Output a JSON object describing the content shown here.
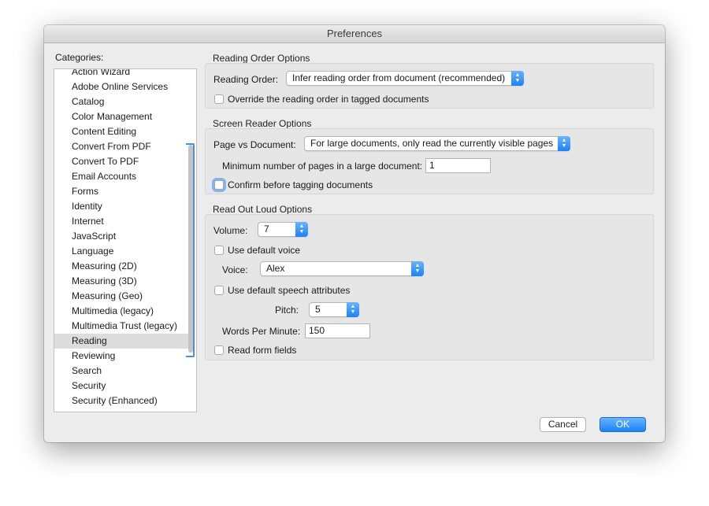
{
  "window": {
    "title": "Preferences"
  },
  "sidebar": {
    "label": "Categories:",
    "items": [
      {
        "label": "Action Wizard"
      },
      {
        "label": "Adobe Online Services"
      },
      {
        "label": "Catalog"
      },
      {
        "label": "Color Management"
      },
      {
        "label": "Content Editing"
      },
      {
        "label": "Convert From PDF"
      },
      {
        "label": "Convert To PDF"
      },
      {
        "label": "Email Accounts"
      },
      {
        "label": "Forms"
      },
      {
        "label": "Identity"
      },
      {
        "label": "Internet"
      },
      {
        "label": "JavaScript"
      },
      {
        "label": "Language"
      },
      {
        "label": "Measuring (2D)"
      },
      {
        "label": "Measuring (3D)"
      },
      {
        "label": "Measuring (Geo)"
      },
      {
        "label": "Multimedia (legacy)"
      },
      {
        "label": "Multimedia Trust (legacy)"
      },
      {
        "label": "Reading",
        "selected": true
      },
      {
        "label": "Reviewing"
      },
      {
        "label": "Search"
      },
      {
        "label": "Security"
      },
      {
        "label": "Security (Enhanced)"
      }
    ]
  },
  "reading_order": {
    "section_title": "Reading Order Options",
    "label": "Reading Order:",
    "value": "Infer reading order from document (recommended)",
    "override_label": "Override the reading order in tagged documents",
    "override_checked": false
  },
  "screen_reader": {
    "section_title": "Screen Reader Options",
    "page_vs_doc_label": "Page vs Document:",
    "page_vs_doc_value": "For large documents, only read the currently visible pages",
    "min_pages_label": "Minimum number of pages in a large document:",
    "min_pages_value": "1",
    "confirm_label": "Confirm before tagging documents",
    "confirm_checked": false
  },
  "read_out_loud": {
    "section_title": "Read Out Loud Options",
    "volume_label": "Volume:",
    "volume_value": "7",
    "default_voice_label": "Use default voice",
    "default_voice_checked": false,
    "voice_label": "Voice:",
    "voice_value": "Alex",
    "default_speech_label": "Use default speech attributes",
    "default_speech_checked": false,
    "pitch_label": "Pitch:",
    "pitch_value": "5",
    "wpm_label": "Words Per Minute:",
    "wpm_value": "150",
    "read_form_label": "Read form fields",
    "read_form_checked": false
  },
  "buttons": {
    "cancel": "Cancel",
    "ok": "OK"
  },
  "colors": {
    "accent": "#1a82fb",
    "focus_ring": "#4a90e2",
    "selection": "#dcdcdc"
  }
}
